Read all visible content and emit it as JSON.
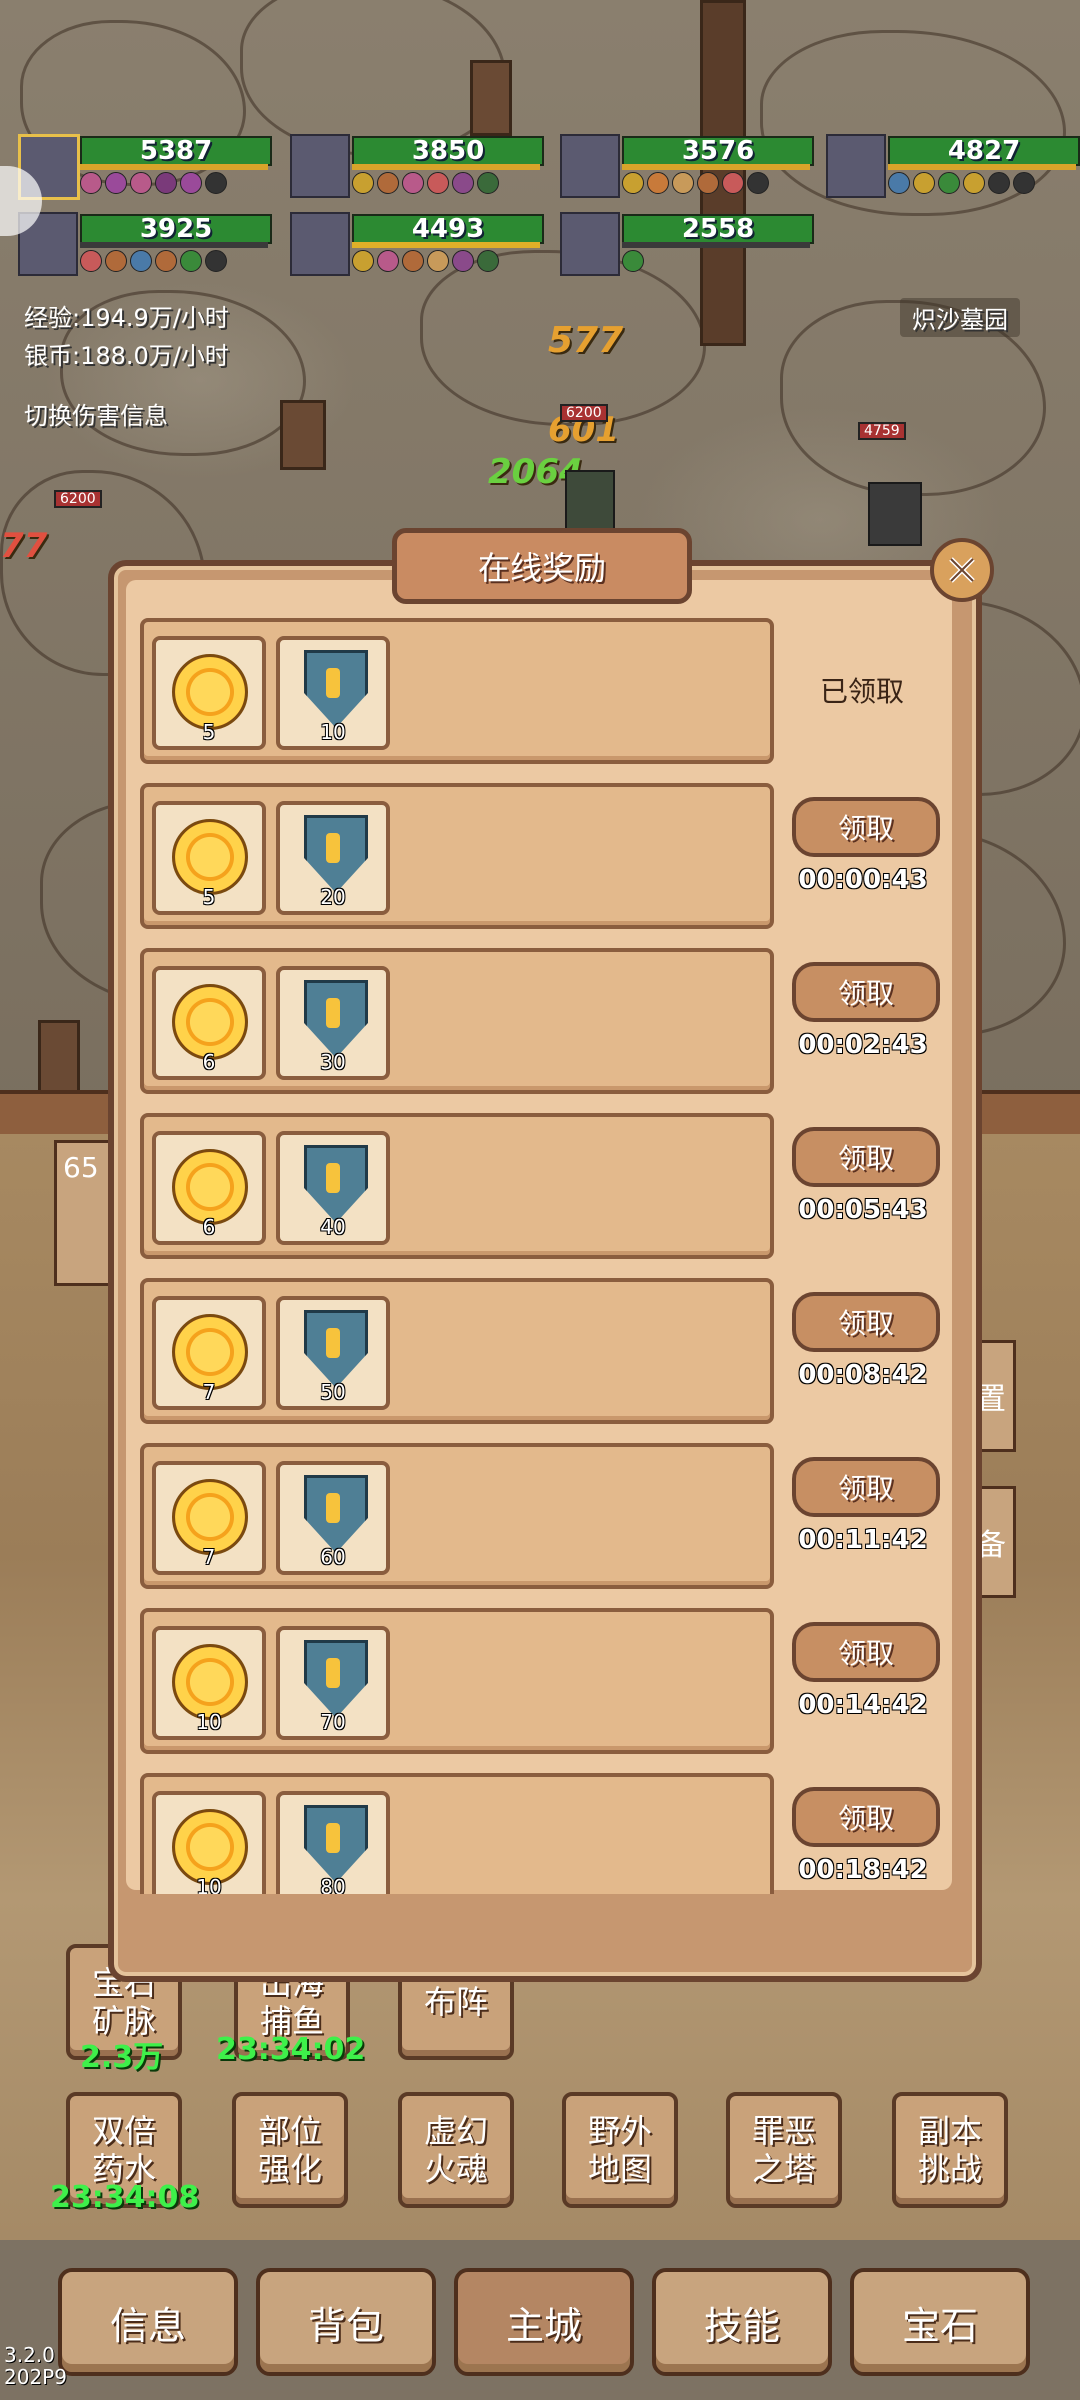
{
  "heroes": [
    {
      "hp": "5387",
      "selected": true
    },
    {
      "hp": "3850",
      "selected": false
    },
    {
      "hp": "3576",
      "selected": false
    },
    {
      "hp": "4827",
      "selected": false
    },
    {
      "hp": "3925",
      "selected": false
    },
    {
      "hp": "4493",
      "selected": false
    },
    {
      "hp": "2558",
      "selected": false
    }
  ],
  "stats": {
    "exp_rate": "经验:194.9万/小时",
    "silver_rate": "银币:188.0万/小时",
    "toggle_damage": "切换伤害信息",
    "location": "炽沙墓园"
  },
  "battle": {
    "dmg_1": "577",
    "dmg_2": "601",
    "dmg_3": "2064",
    "dmg_4": "77",
    "enemy_hp_1": "6200",
    "enemy_hp_2": "6200",
    "enemy_hp_3": "4759",
    "side_num": "65"
  },
  "dialog": {
    "title": "在线奖励",
    "rows": [
      {
        "coin_qty": "5",
        "shield_qty": "10",
        "status": "已领取",
        "claim_label": "",
        "timer": ""
      },
      {
        "coin_qty": "5",
        "shield_qty": "20",
        "status": "",
        "claim_label": "领取",
        "timer": "00:00:43"
      },
      {
        "coin_qty": "6",
        "shield_qty": "30",
        "status": "",
        "claim_label": "领取",
        "timer": "00:02:43"
      },
      {
        "coin_qty": "6",
        "shield_qty": "40",
        "status": "",
        "claim_label": "领取",
        "timer": "00:05:43"
      },
      {
        "coin_qty": "7",
        "shield_qty": "50",
        "status": "",
        "claim_label": "领取",
        "timer": "00:08:42"
      },
      {
        "coin_qty": "7",
        "shield_qty": "60",
        "status": "",
        "claim_label": "领取",
        "timer": "00:11:42"
      },
      {
        "coin_qty": "10",
        "shield_qty": "70",
        "status": "",
        "claim_label": "领取",
        "timer": "00:14:42"
      },
      {
        "coin_qty": "10",
        "shield_qty": "80",
        "status": "",
        "claim_label": "领取",
        "timer": "00:18:42"
      }
    ]
  },
  "menu": {
    "gem_mine": "宝石矿脉",
    "gem_mine_value": "2.3万",
    "fishing": "出海捕鱼",
    "fishing_timer": "23:34:02",
    "formation": "布阵",
    "double_potion": "双倍药水",
    "double_potion_timer": "23:34:08",
    "part_enhance": "部位强化",
    "illusion_soul": "虚幻火魂",
    "field_map": "野外地图",
    "sin_tower": "罪恶之塔",
    "dungeon": "副本挑战",
    "side_right_1": "置",
    "side_right_2": "备"
  },
  "nav": {
    "tabs": [
      "信息",
      "背包",
      "主城",
      "技能",
      "宝石"
    ],
    "active_index": 2
  },
  "version": {
    "line1": "3.2.0",
    "line2": "202P9"
  }
}
